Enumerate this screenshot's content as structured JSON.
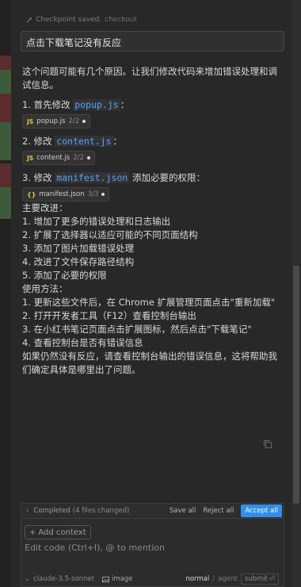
{
  "checkpoint": {
    "text": "Checkpoint saved.",
    "link": "checkout"
  },
  "query": "点击下载笔记没有反应",
  "response": {
    "intro": "这个问题可能有几个原因。让我们修改代码来增加错误处理和调试信息。",
    "steps": [
      {
        "prefix": "1. 首先修改 ",
        "code": "popup.js",
        "suffix": "：",
        "file": "popup.js",
        "count": "2/2",
        "icon": "js"
      },
      {
        "prefix": "2. 修改 ",
        "code": "content.js",
        "suffix": "：",
        "file": "content.js",
        "count": "2/2",
        "icon": "js"
      },
      {
        "prefix": "3. 修改 ",
        "code": "manifest.json",
        "suffix": " 添加必要的权限：",
        "file": "manifest.json",
        "count": "3/3",
        "icon": "json"
      }
    ],
    "improvements_heading": "主要改进：",
    "improvements": [
      "1. 增加了更多的错误处理和日志输出",
      "2. 扩展了选择器以适应可能的不同页面结构",
      "3. 添加了图片加载错误处理",
      "4. 改进了文件保存路径结构",
      "5. 添加了必要的权限"
    ],
    "usage_heading": "使用方法：",
    "usage": [
      "1. 更新这些文件后，在 Chrome 扩展管理页面点击\"重新加载\"",
      "2. 打开开发者工具（F12）查看控制台输出",
      "3. 在小红书笔记页面点击扩展图标，然后点击\"下载笔记\"",
      "4. 查看控制台是否有错误信息"
    ],
    "closing": "如果仍然没有反应，请查看控制台输出的错误信息，这将帮助我们确定具体是哪里出了问题。"
  },
  "completed": {
    "label": "Completed",
    "count": "(4 files changed)",
    "save_all": "Save all",
    "reject_all": "Reject all",
    "accept_all": "Accept all"
  },
  "composer": {
    "add_context": "Add context",
    "placeholder": "Edit code (Ctrl+I), @ to mention",
    "model": "claude-3.5-sonnet",
    "image": "image",
    "mode_normal": "normal",
    "mode_sep": "/",
    "mode_agent": "agent",
    "submit": "submit"
  },
  "colors": {
    "accent": "#2f8ff0",
    "code": "#4ea6ff",
    "js_icon": "#e3c64a"
  }
}
